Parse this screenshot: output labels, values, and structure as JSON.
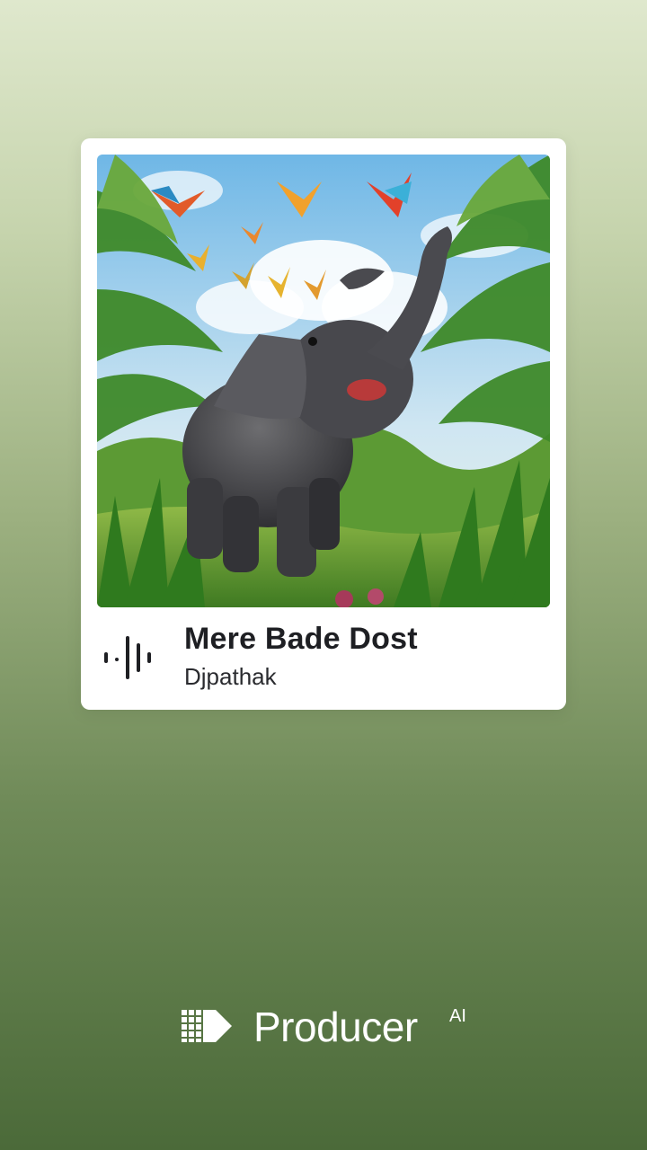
{
  "card": {
    "title": "Mere Bade Dost",
    "artist": "Djpathak",
    "artwork_icon": "elephant-with-birds-artwork",
    "wave_icon": "sound-wave-icon"
  },
  "brand": {
    "name": "Producer",
    "suffix": "AI",
    "logo_icon": "producer-ai-logo-icon"
  },
  "colors": {
    "background_top": "#dfe8cd",
    "background_bottom": "#4b6a39",
    "card": "#ffffff",
    "title_text": "#1e1f23",
    "brand_text": "#ffffff"
  }
}
